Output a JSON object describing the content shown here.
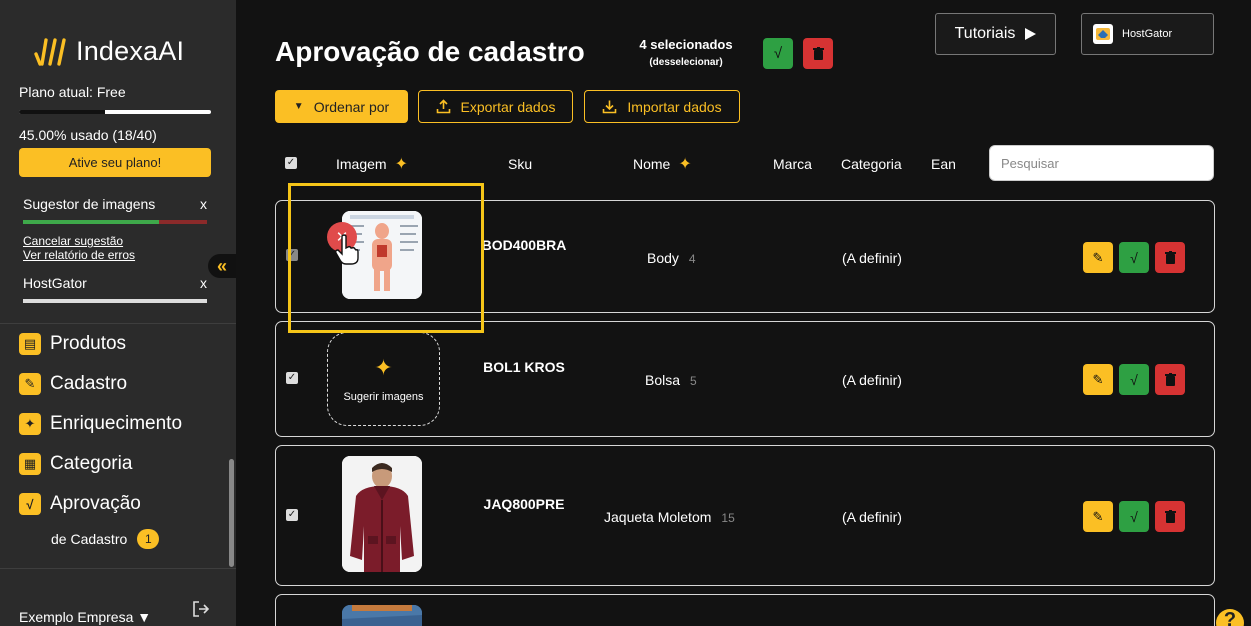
{
  "app": {
    "name": "IndexaAI"
  },
  "sidebar": {
    "plan_label": "Plano atual: Free",
    "usage_text": "45.00% usado (18/40)",
    "usage_fraction": 0.45,
    "activate_label": "Ative seu plano!",
    "tasks": [
      {
        "title": "Sugestor de imagens",
        "close": "x",
        "links": [
          "Cancelar sugestão",
          "Ver relatório de erros"
        ]
      },
      {
        "title": "HostGator",
        "close": "x"
      }
    ],
    "collapse": "«",
    "nav": [
      {
        "label": "Produtos",
        "icon": "clipboard-icon"
      },
      {
        "label": "Cadastro",
        "icon": "pencil-icon"
      },
      {
        "label": "Enriquecimento",
        "icon": "sparkle-icon"
      },
      {
        "label": "Categoria",
        "icon": "grid-icon"
      },
      {
        "label": "Aprovação",
        "icon": "check-icon"
      }
    ],
    "nav_sub": {
      "label": "de Cadastro",
      "badge": "1"
    },
    "company": "Exemplo Empresa ▼"
  },
  "header": {
    "title": "Aprovação de cadastro",
    "selected_count": "4 selecionados",
    "deselect": "(desselecionar)",
    "approve_symbol": "√",
    "tutorials_label": "Tutoriais",
    "store_label": "HostGator"
  },
  "toolbar": {
    "order_label": "Ordenar por",
    "export_label": "Exportar dados",
    "import_label": "Importar dados"
  },
  "table": {
    "columns": {
      "image": "Imagem",
      "sku": "Sku",
      "name": "Nome",
      "brand": "Marca",
      "category": "Categoria",
      "ean": "Ean"
    },
    "search_placeholder": "Pesquisar",
    "suggest_label": "Sugerir imagens",
    "check_symbol": "✓",
    "rows": [
      {
        "sku": "BOD400BRA",
        "name": "Body",
        "count": "4",
        "category": "(A definir)"
      },
      {
        "sku": "BOL1 KROS",
        "name": "Bolsa",
        "count": "5",
        "category": "(A definir)"
      },
      {
        "sku": "JAQ800PRE",
        "name": "Jaqueta Moletom",
        "count": "15",
        "category": "(A definir)"
      }
    ]
  },
  "colors": {
    "accent": "#fbbf24",
    "approve": "#2ea043",
    "delete": "#d63333",
    "background": "#121212",
    "sidebar": "#2b2b2b"
  },
  "help": "?"
}
